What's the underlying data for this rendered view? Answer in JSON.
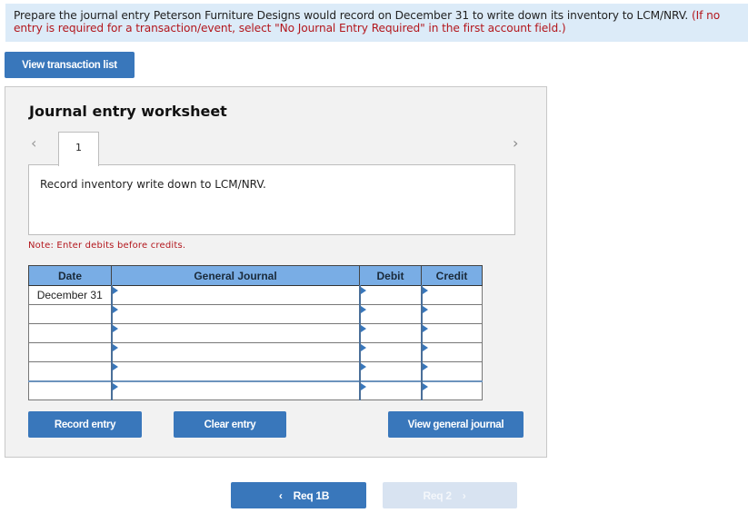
{
  "instructions": {
    "main_text": "Prepare the journal entry Peterson Furniture Designs would record on December 31 to write down its inventory to LCM/NRV.",
    "note_text": "(If no entry is required for a transaction/event, select \"No Journal Entry Required\" in the first account field.)"
  },
  "toolbar": {
    "view_transaction_list_label": "View transaction list"
  },
  "worksheet": {
    "title": "Journal entry worksheet",
    "prev_icon": "chevron-left-icon",
    "next_icon": "chevron-right-icon",
    "tabs": [
      {
        "label": "1",
        "active": true
      }
    ],
    "description": "Record inventory write down to LCM/NRV.",
    "note": "Note: Enter debits before credits.",
    "table": {
      "headers": {
        "date": "Date",
        "account": "General Journal",
        "debit": "Debit",
        "credit": "Credit"
      },
      "rows": [
        {
          "date": "December 31",
          "account": "",
          "debit": "",
          "credit": ""
        },
        {
          "date": "",
          "account": "",
          "debit": "",
          "credit": ""
        },
        {
          "date": "",
          "account": "",
          "debit": "",
          "credit": ""
        },
        {
          "date": "",
          "account": "",
          "debit": "",
          "credit": ""
        },
        {
          "date": "",
          "account": "",
          "debit": "",
          "credit": ""
        },
        {
          "date": "",
          "account": "",
          "debit": "",
          "credit": ""
        }
      ]
    },
    "buttons": {
      "record_entry": "Record entry",
      "clear_entry": "Clear entry",
      "view_general_journal": "View general journal"
    }
  },
  "navigation": {
    "prev_label": "Req 1B",
    "prev_icon": "‹",
    "next_label": "Req 2",
    "next_icon": "›",
    "next_disabled": true
  },
  "colors": {
    "accent": "#3977bb",
    "header_bg": "#79ade5",
    "instruction_bg": "#dcebf8",
    "note_red": "#b3171d",
    "disabled_button": "#d8e3f1"
  }
}
